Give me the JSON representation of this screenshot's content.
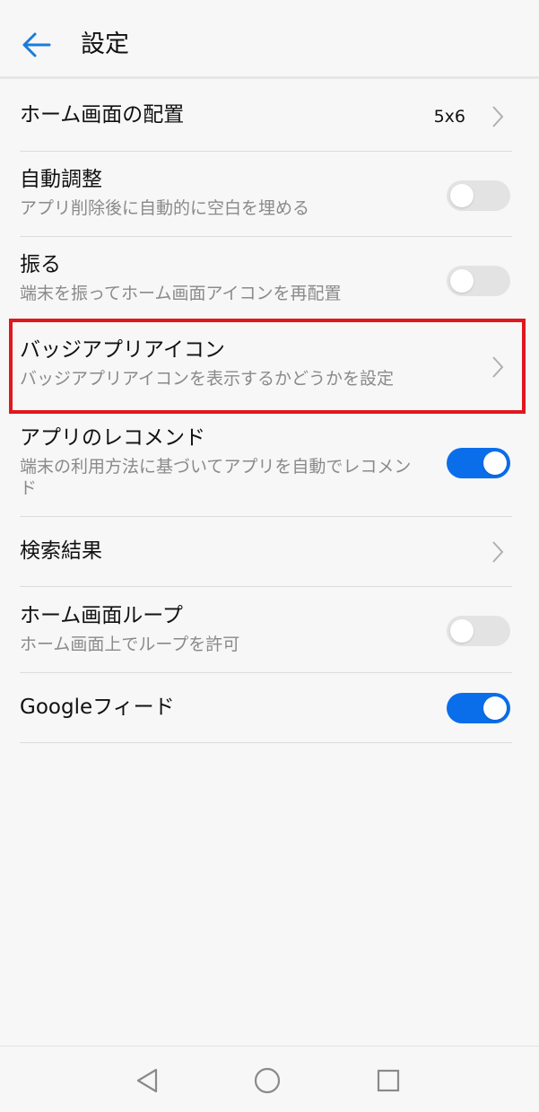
{
  "header": {
    "title": "設定"
  },
  "settings": [
    {
      "title": "ホーム画面の配置",
      "value": "5x6",
      "control": "chevron"
    },
    {
      "title": "自動調整",
      "subtitle": "アプリ削除後に自動的に空白を埋める",
      "control": "toggle",
      "on": false
    },
    {
      "title": "振る",
      "subtitle": "端末を振ってホーム画面アイコンを再配置",
      "control": "toggle",
      "on": false
    },
    {
      "title": "バッジアプリアイコン",
      "subtitle": "バッジアプリアイコンを表示するかどうかを設定",
      "control": "chevron",
      "highlighted": true
    },
    {
      "title": "アプリのレコメンド",
      "subtitle": "端末の利用方法に基づいてアプリを自動でレコメンド",
      "control": "toggle",
      "on": true
    },
    {
      "title": "検索結果",
      "control": "chevron"
    },
    {
      "title": "ホーム画面ループ",
      "subtitle": "ホーム画面上でループを許可",
      "control": "toggle",
      "on": false
    },
    {
      "title": "Googleフィード",
      "control": "toggle",
      "on": true
    }
  ],
  "colors": {
    "accent": "#0a6eea",
    "highlight": "#e0181e"
  },
  "navbar": {
    "icons": [
      "back-triangle-icon",
      "home-circle-icon",
      "recents-square-icon"
    ]
  }
}
